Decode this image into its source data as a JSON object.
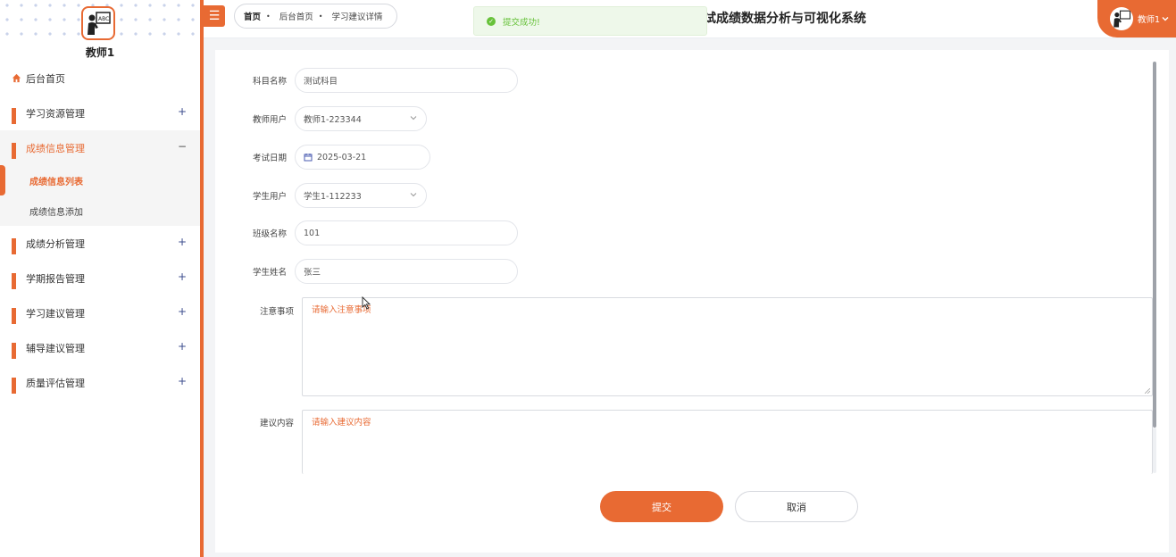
{
  "sidebar": {
    "username": "教师1",
    "home_label": "后台首页",
    "items": [
      {
        "label": "学习资源管理",
        "toggle": "+"
      },
      {
        "label": "成绩信息管理",
        "toggle": "−"
      },
      {
        "label": "成绩分析管理",
        "toggle": "+"
      },
      {
        "label": "学期报告管理",
        "toggle": "+"
      },
      {
        "label": "学习建议管理",
        "toggle": "+"
      },
      {
        "label": "辅导建议管理",
        "toggle": "+"
      },
      {
        "label": "质量评估管理",
        "toggle": "+"
      }
    ],
    "submenu": [
      {
        "label": "成绩信息列表"
      },
      {
        "label": "成绩信息添加"
      }
    ]
  },
  "header": {
    "menu_icon": "☰",
    "breadcrumb": [
      "首页",
      "后台首页",
      "学习建议详情"
    ],
    "breadcrumb_sep": "•",
    "toast": "提交成功!",
    "site_title": "试成绩数据分析与可视化系统",
    "user_label": "教师1"
  },
  "form": {
    "subject": {
      "label": "科目名称",
      "value": "测试科目"
    },
    "teacher": {
      "label": "教师用户",
      "value": "教师1-223344"
    },
    "exam_date": {
      "label": "考试日期",
      "value": "2025-03-21"
    },
    "student": {
      "label": "学生用户",
      "value": "学生1-112233"
    },
    "class_name": {
      "label": "班级名称",
      "value": "101"
    },
    "student_name": {
      "label": "学生姓名",
      "value": "张三"
    },
    "notes": {
      "label": "注意事项",
      "placeholder": "请输入注意事项"
    },
    "advice": {
      "label": "建议内容",
      "placeholder": "请输入建议内容"
    }
  },
  "actions": {
    "submit": "提交",
    "cancel": "取消"
  },
  "colors": {
    "accent": "#e86a33",
    "success": "#67c23a"
  }
}
